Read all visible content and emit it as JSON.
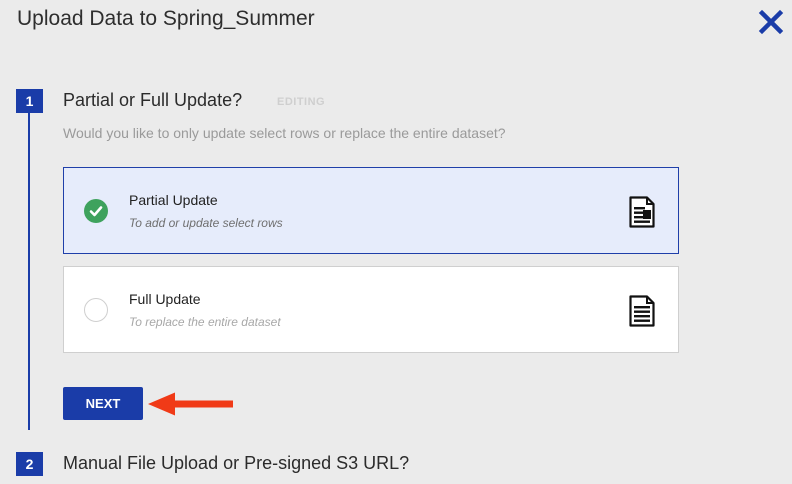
{
  "dialog": {
    "title": "Upload Data to Spring_Summer",
    "close_icon": "close-icon"
  },
  "step1": {
    "number": "1",
    "title": "Partial or Full Update?",
    "status": "EDITING",
    "description": "Would you like to only update select rows or replace the entire dataset?",
    "options": [
      {
        "title": "Partial Update",
        "subtitle": "To add or update select rows",
        "selected": true,
        "icon": "document-partial-icon"
      },
      {
        "title": "Full Update",
        "subtitle": "To replace the entire dataset",
        "selected": false,
        "icon": "document-full-icon"
      }
    ],
    "next_label": "NEXT"
  },
  "step2": {
    "number": "2",
    "title": "Manual File Upload or Pre-signed S3 URL?"
  },
  "colors": {
    "accent": "#1a3ca8",
    "selected_bg": "#e6ecfb",
    "check": "#3ea25d",
    "arrow": "#f03a17"
  }
}
